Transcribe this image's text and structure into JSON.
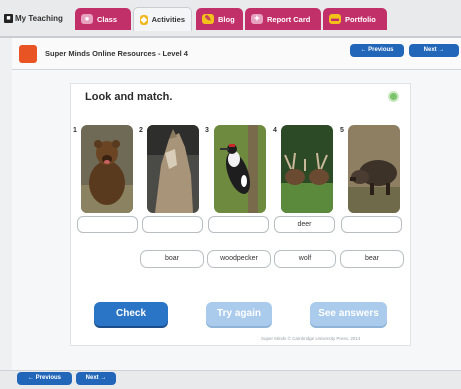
{
  "topnav": {
    "my_teaching": "My Teaching",
    "tabs": [
      {
        "label": "Class",
        "icon": "class-icon"
      },
      {
        "label": "Activities",
        "icon": "activities-icon"
      },
      {
        "label": "Blog",
        "icon": "blog-icon"
      },
      {
        "label": "Report Card",
        "icon": "report-card-icon"
      },
      {
        "label": "Portfolio",
        "icon": "portfolio-icon"
      }
    ],
    "active_tab": "Activities"
  },
  "header": {
    "title": "Super Minds Online Resources - Level 4",
    "prev_label": "← Previous",
    "next_label": "Next →"
  },
  "activity": {
    "instruction": "Look and match.",
    "items": [
      {
        "number": "1",
        "animal": "bear",
        "slot": ""
      },
      {
        "number": "2",
        "animal": "wolf",
        "slot": ""
      },
      {
        "number": "3",
        "animal": "woodpecker",
        "slot": ""
      },
      {
        "number": "4",
        "animal": "deer",
        "slot": "deer"
      },
      {
        "number": "5",
        "animal": "boar",
        "slot": ""
      }
    ],
    "word_bank": [
      "boar",
      "woodpecker",
      "wolf",
      "bear"
    ],
    "buttons": {
      "check": "Check",
      "try_again": "Try again",
      "see_answers": "See answers"
    },
    "copyright": "Super Minds © Cambridge University Press, 2014"
  },
  "footer": {
    "prev_label": "← Previous",
    "next_label": "Next →"
  },
  "colors": {
    "tab_magenta": "#c2306a",
    "nav_blue": "#2166b8",
    "check_blue": "#2b75c7",
    "disabled_blue": "#aacbec",
    "logo_orange": "#e85424"
  }
}
